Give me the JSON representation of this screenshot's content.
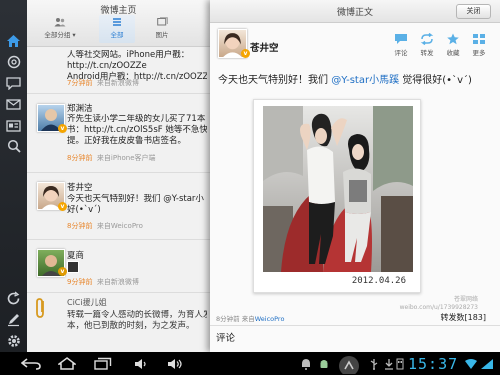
{
  "timeline": {
    "title": "微博主页",
    "tabs": [
      {
        "label": "全部分组 ▾",
        "icon": "group-icon"
      },
      {
        "label": "全部",
        "icon": "list-icon"
      },
      {
        "label": "图片",
        "icon": "image-icon"
      }
    ],
    "tweets": [
      {
        "lines": [
          "人等社交网站。iPhone用户戳：",
          "http://t.cn/zOOZZe",
          "Android用户戳：http://t.cn/zOOZZe"
        ],
        "time": "7分钟前",
        "source": "来自新浪微博"
      },
      {
        "name": "郑渊洁",
        "lines": [
          "齐先生读小学二年级的女儿买了71本",
          "书：http://t.cn/zOlS5sF 她等不急快递",
          "提。正好我在皮皮鲁书店签名。"
        ],
        "time": "8分钟前",
        "source": "来自iPhone客户端"
      },
      {
        "name": "苍井空",
        "lines": [
          "今天也天气特别好！我们 @Y-star小",
          "好(•`v´)"
        ],
        "time": "8分钟前",
        "source": "来自WeicoPro"
      },
      {
        "name": "夏商",
        "lines": [],
        "time": "9分钟前",
        "source": "来自新浪微博"
      },
      {
        "name": "CiCi援儿姐",
        "lines": [
          "转载一篇令人感动的长微博，为育人发声",
          "本，他已到散的时刻，为之发声。"
        ],
        "time": "",
        "source": ""
      }
    ]
  },
  "detail": {
    "title": "微博正文",
    "close_label": "关闭",
    "author": "苍井空",
    "actions": [
      {
        "label": "评论",
        "icon": "comment-icon"
      },
      {
        "label": "转发",
        "icon": "repost-icon"
      },
      {
        "label": "收藏",
        "icon": "favorite-icon"
      },
      {
        "label": "更多",
        "icon": "more-icon"
      }
    ],
    "text_before": "今天也天气特别好！我们 ",
    "mention": "@Y-star小馬蹊",
    "text_after": " 觉得很好(•`v´)",
    "photo_date": "2012.04.26",
    "watermark": "苍翠网络",
    "watermark_url": "weibo.com/u/1739928273",
    "meta_time": "8分钟前",
    "meta_source_prefix": "来自",
    "meta_source": "WeicoPro",
    "reposts": "转发数[183]",
    "comments_label": "评论"
  },
  "statusbar": {
    "time": "15:37"
  },
  "colors": {
    "accent": "#1f6fc4",
    "time_orange": "#e8872e",
    "clock_blue": "#39b7e8"
  }
}
